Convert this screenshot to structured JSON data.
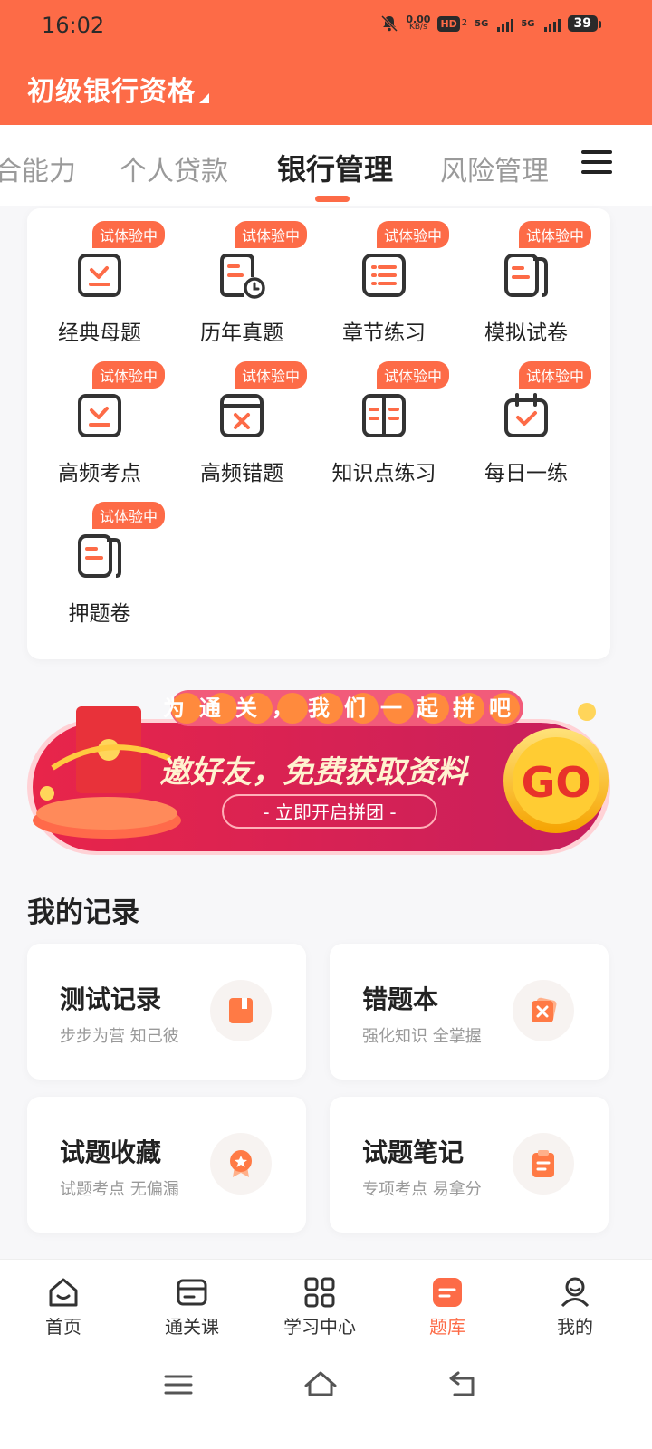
{
  "status": {
    "time": "16:02",
    "net_speed_value": "0.00",
    "net_speed_unit": "KB/s",
    "hd_label": "HD",
    "hd_sub": "2",
    "sim1": "5G",
    "sim2": "5G",
    "battery": "39"
  },
  "header": {
    "title": "初级银行资格"
  },
  "tabs": [
    {
      "label": "合能力"
    },
    {
      "label": "个人贷款"
    },
    {
      "label": "银行管理"
    },
    {
      "label": "风险管理"
    }
  ],
  "features": {
    "badge": "试体验中",
    "items": [
      {
        "label": "经典母题",
        "icon": "check-doc-icon"
      },
      {
        "label": "历年真题",
        "icon": "clock-doc-icon"
      },
      {
        "label": "章节练习",
        "icon": "list-icon"
      },
      {
        "label": "模拟试卷",
        "icon": "paper-stack-icon"
      },
      {
        "label": "高频考点",
        "icon": "check-doc-icon"
      },
      {
        "label": "高频错题",
        "icon": "x-window-icon"
      },
      {
        "label": "知识点练习",
        "icon": "book-open-icon"
      },
      {
        "label": "每日一练",
        "icon": "calendar-check-icon"
      },
      {
        "label": "押题卷",
        "icon": "paper-stack-icon"
      }
    ]
  },
  "banner": {
    "top_text": "为通关，我们一起拼吧",
    "main_text": "邀好友，免费获取资料",
    "sub_text": "- 立即开启拼团 -",
    "go_text": "GO"
  },
  "records": {
    "title": "我的记录",
    "items": [
      {
        "title": "测试记录",
        "subtitle": "步步为营 知己彼",
        "icon": "bookmark-icon"
      },
      {
        "title": "错题本",
        "subtitle": "强化知识 全掌握",
        "icon": "x-card-icon"
      },
      {
        "title": "试题收藏",
        "subtitle": "试题考点 无偏漏",
        "icon": "award-icon"
      },
      {
        "title": "试题笔记",
        "subtitle": "专项考点 易拿分",
        "icon": "clipboard-icon"
      }
    ]
  },
  "bottom_nav": [
    {
      "label": "首页",
      "icon": "home-icon"
    },
    {
      "label": "通关课",
      "icon": "card-icon"
    },
    {
      "label": "学习中心",
      "icon": "grid-icon"
    },
    {
      "label": "题库",
      "icon": "question-bank-icon"
    },
    {
      "label": "我的",
      "icon": "profile-icon"
    }
  ],
  "colors": {
    "accent": "#fd6b47",
    "text": "#222222",
    "muted": "#999999"
  }
}
